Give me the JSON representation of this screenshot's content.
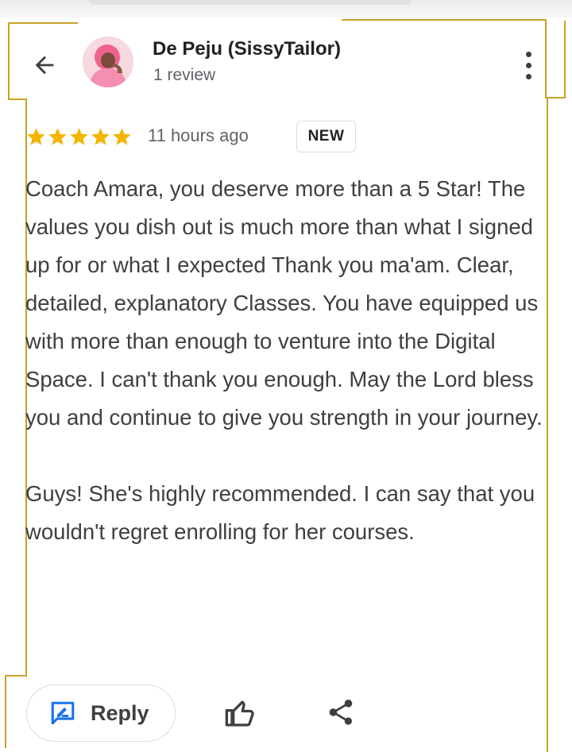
{
  "reviewer": {
    "name": "De Peju (SissyTailor)",
    "review_count": "1 review"
  },
  "review": {
    "rating": 5,
    "max_rating": 5,
    "time": "11 hours ago",
    "badge": "NEW",
    "paragraphs": [
      "Coach Amara, you deserve more than a 5 Star! The values you dish out is much more than what I signed up for or what I expected Thank you ma'am. Clear, detailed, explanatory Classes. You have equipped us with more than enough to venture into the Digital Space. I can't thank you enough. May the Lord bless you and continue to give you strength in your journey.",
      "Guys! She's highly recommended. I can say that you wouldn't regret enrolling for her courses."
    ]
  },
  "actions": {
    "reply_label": "Reply"
  },
  "colors": {
    "star": "#f4b400",
    "frame": "#c9a227",
    "reply_icon": "#1a73e8"
  },
  "icons": [
    "back-arrow-icon",
    "more-vert-icon",
    "star-icon",
    "reply-icon",
    "thumb-up-icon",
    "share-icon"
  ]
}
